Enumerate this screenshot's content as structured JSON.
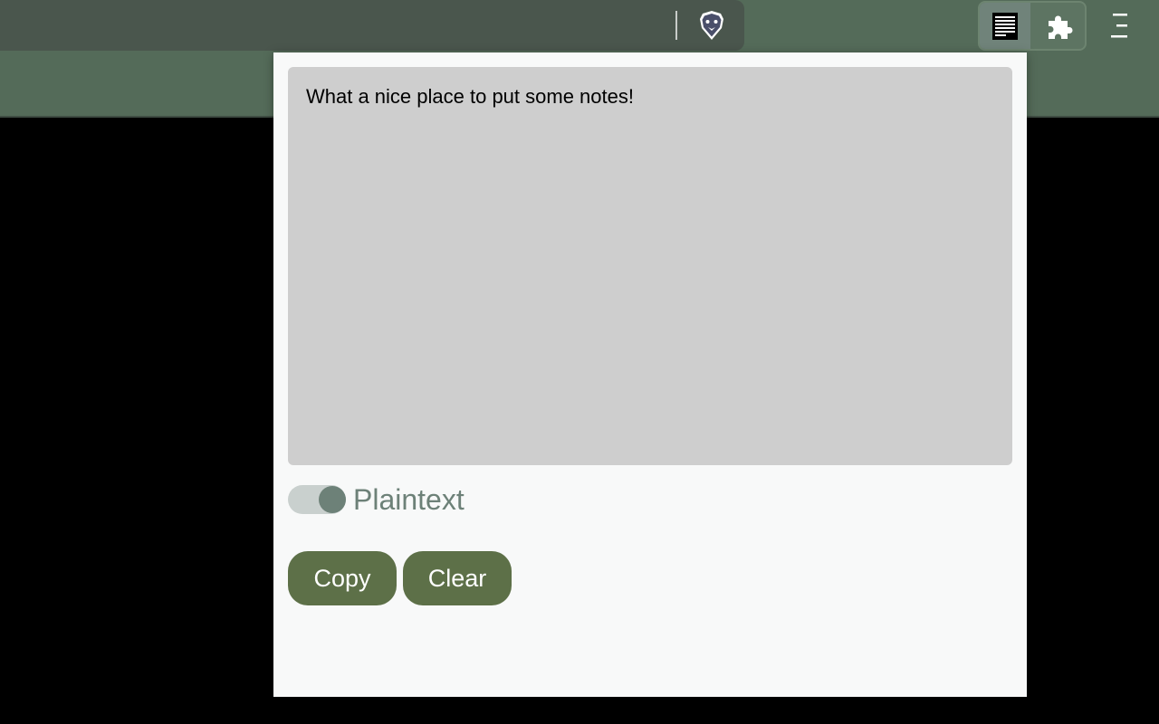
{
  "browser": {
    "toolbar_icons": {
      "shields": "brave-lion-icon",
      "notes_extension": "notes-document-icon",
      "extensions": "puzzle-icon",
      "menu": "hamburger-menu-icon"
    }
  },
  "popup": {
    "notes_text": "What a nice place to put some notes!",
    "toggle": {
      "label": "Plaintext",
      "checked": true
    },
    "buttons": {
      "copy_label": "Copy",
      "clear_label": "Clear"
    }
  },
  "colors": {
    "accent": "#5d7048",
    "toolbar": "#546b59",
    "toggle_knob": "#6d8178"
  }
}
